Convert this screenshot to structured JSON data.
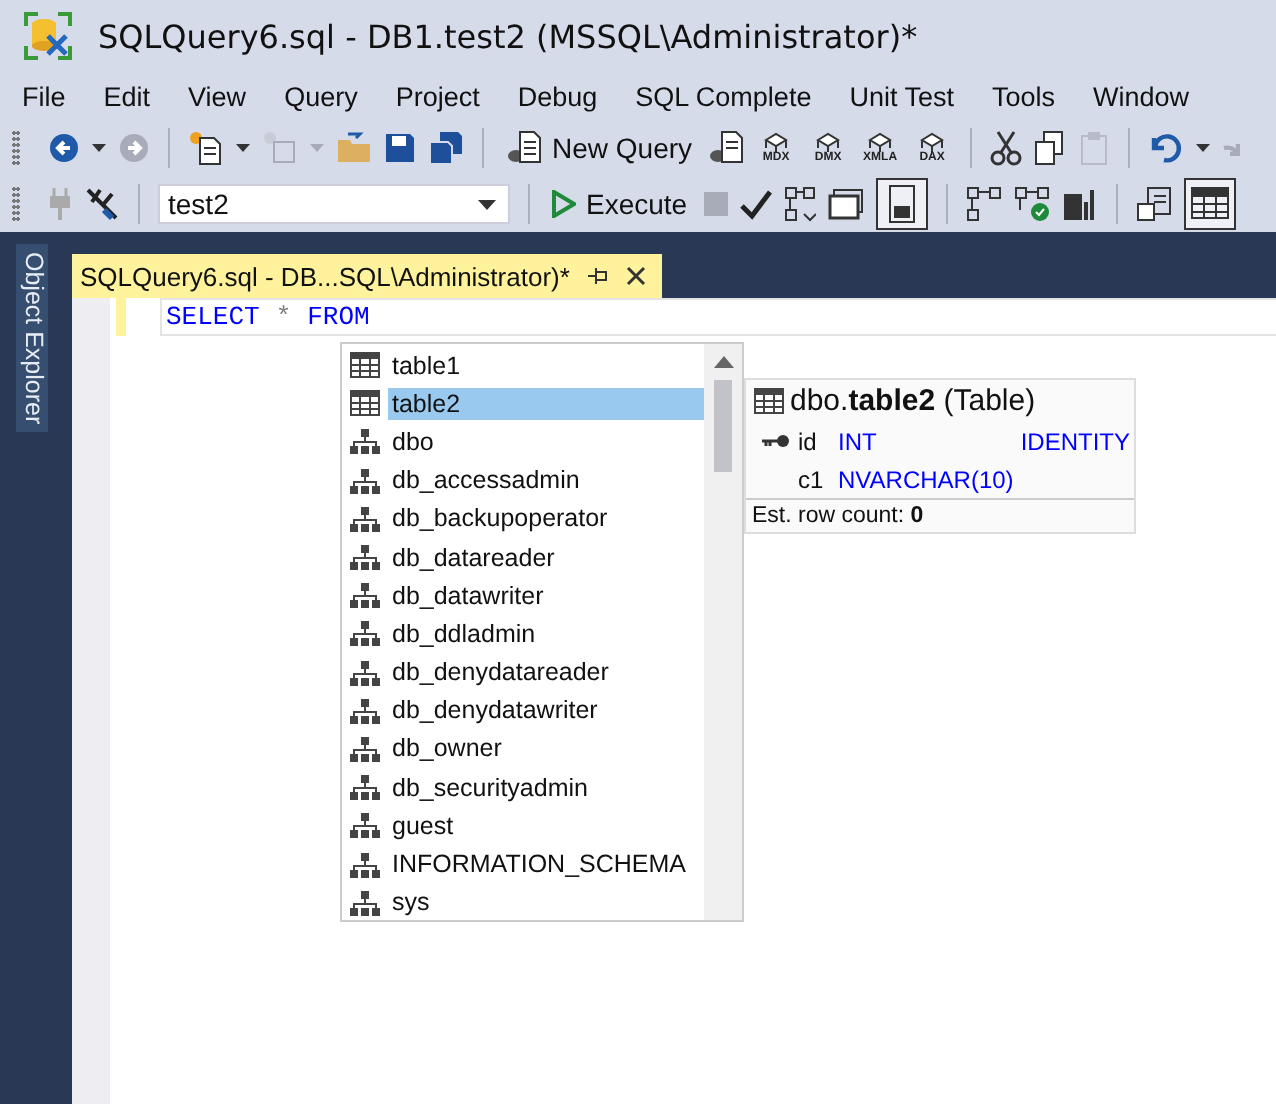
{
  "window": {
    "title": "SQLQuery6.sql - DB1.test2 (MSSQL\\Administrator)*"
  },
  "menu": [
    "File",
    "Edit",
    "View",
    "Query",
    "Project",
    "Debug",
    "SQL Complete",
    "Unit Test",
    "Tools",
    "Window"
  ],
  "toolbar_1": {
    "new_query": "New Query",
    "analysis_buttons": [
      "MDX",
      "DMX",
      "XMLA",
      "DAX"
    ]
  },
  "toolbar_2": {
    "database": "test2",
    "execute": "Execute"
  },
  "sidebar": {
    "tab": "Object Explorer"
  },
  "document_tab": {
    "title": "SQLQuery6.sql - DB...SQL\\Administrator)*"
  },
  "editor": {
    "tokens": [
      {
        "text": "SELECT",
        "kind": "keyword"
      },
      {
        "text": "*",
        "kind": "operator"
      },
      {
        "text": "FROM",
        "kind": "keyword"
      }
    ]
  },
  "completion": {
    "items": [
      {
        "text": "table1",
        "kind": "table",
        "selected": false
      },
      {
        "text": "table2",
        "kind": "table",
        "selected": true
      },
      {
        "text": "dbo",
        "kind": "schema",
        "selected": false
      },
      {
        "text": "db_accessadmin",
        "kind": "schema",
        "selected": false
      },
      {
        "text": "db_backupoperator",
        "kind": "schema",
        "selected": false
      },
      {
        "text": "db_datareader",
        "kind": "schema",
        "selected": false
      },
      {
        "text": "db_datawriter",
        "kind": "schema",
        "selected": false
      },
      {
        "text": "db_ddladmin",
        "kind": "schema",
        "selected": false
      },
      {
        "text": "db_denydatareader",
        "kind": "schema",
        "selected": false
      },
      {
        "text": "db_denydatawriter",
        "kind": "schema",
        "selected": false
      },
      {
        "text": "db_owner",
        "kind": "schema",
        "selected": false
      },
      {
        "text": "db_securityadmin",
        "kind": "schema",
        "selected": false
      },
      {
        "text": "guest",
        "kind": "schema",
        "selected": false
      },
      {
        "text": "INFORMATION_SCHEMA",
        "kind": "schema",
        "selected": false
      },
      {
        "text": "sys",
        "kind": "schema",
        "selected": false
      }
    ]
  },
  "tooltip": {
    "heading": "dbo.**table2** (Table)",
    "columns": [
      {
        "name": "id",
        "type": "INT",
        "extra": "IDENTITY",
        "primary_key": true
      },
      {
        "name": "c1",
        "type": "NVARCHAR(10)",
        "primary_key": false
      }
    ],
    "row_count": "Est. row count: **0**"
  }
}
